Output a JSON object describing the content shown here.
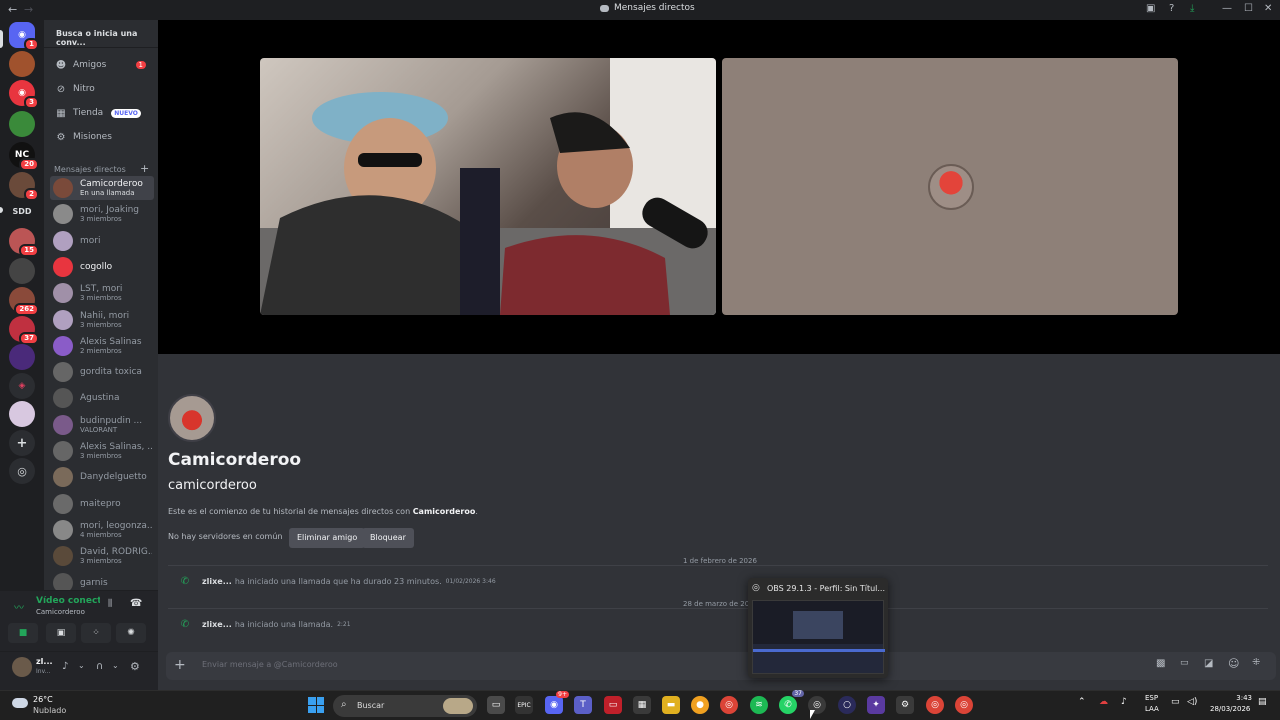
{
  "window": {
    "title": "Mensajes directos",
    "back_glyph": "←",
    "forward_glyph": "→",
    "controls": [
      "▣",
      "?",
      "⤓",
      "—",
      "☐",
      "✕"
    ]
  },
  "rail": {
    "badges": [
      "1",
      "3",
      "20",
      "2",
      "15",
      "262",
      "37"
    ],
    "sdd_label": "SDD",
    "nc_label": "NC"
  },
  "sidebar": {
    "search_placeholder": "Busca o inicia una conv...",
    "nav": [
      {
        "label": "Amigos",
        "icon": "friends-icon",
        "badge": "1"
      },
      {
        "label": "Nitro",
        "icon": "nitro-icon"
      },
      {
        "label": "Tienda",
        "icon": "shop-icon",
        "tag": "NUEVO"
      },
      {
        "label": "Misiones",
        "icon": "quests-icon"
      }
    ],
    "dm_header": "Mensajes directos",
    "dm_add": "+",
    "dms": [
      {
        "name": "Camicorderoo",
        "sub": "En una llamada",
        "color": "#7a4a3a"
      },
      {
        "name": "mori, Joaking",
        "sub": "3 miembros",
        "color": "#8a8a8a"
      },
      {
        "name": "mori",
        "sub": "",
        "color": "#b0a0c0"
      },
      {
        "name": "cogollo",
        "sub": "",
        "color": "#e8353f"
      },
      {
        "name": "LST, mori",
        "sub": "3 miembros",
        "color": "#a090a8"
      },
      {
        "name": "Nahii, mori",
        "sub": "3 miembros",
        "color": "#b0a0c0"
      },
      {
        "name": "Alexis Salinas",
        "sub": "2 miembros",
        "color": "#8a5cc8"
      },
      {
        "name": "gordita toxica",
        "sub": "",
        "color": "#666"
      },
      {
        "name": "Agustina",
        "sub": "",
        "color": "#555"
      },
      {
        "name": "budinpudin ...",
        "sub": "VALORANT",
        "color": "#7a5a8a"
      },
      {
        "name": "Alexis Salinas, ...",
        "sub": "3 miembros",
        "color": "#666"
      },
      {
        "name": "Danydelguetto",
        "sub": "",
        "color": "#7a6a5a"
      },
      {
        "name": "maitepro",
        "sub": "",
        "color": "#6a6a6a"
      },
      {
        "name": "mori, leogonza...",
        "sub": "4 miembros",
        "color": "#888"
      },
      {
        "name": "David, RODRIG...",
        "sub": "3 miembros",
        "color": "#5a4a3a"
      },
      {
        "name": "garnis",
        "sub": "",
        "color": "#555"
      }
    ]
  },
  "voice": {
    "status": "Vídeo conectad",
    "channel": "Camicorderoo",
    "user_name": "zl...",
    "user_status": "Inv..."
  },
  "chat": {
    "display_name": "Camicorderoo",
    "username": "camicorderoo",
    "intro_prefix": "Este es el comienzo de tu historial de mensajes directos con ",
    "intro_name": "Camicorderoo",
    "intro_suffix": ".",
    "no_servers": "No hay servidores en común",
    "remove_friend": "Eliminar amigo",
    "block": "Bloquear",
    "date1": "1 de febrero de 2026",
    "call1_user": "zlixe...",
    "call1_text": "ha iniciado una llamada que ha durado 23 minutos.",
    "call1_time": "01/02/2026 3:46",
    "date2": "28 de marzo de 2026",
    "call2_user": "zlixe...",
    "call2_text": "ha iniciado una llamada.",
    "call2_time": "2:21",
    "composer_placeholder": "Enviar mensaje a @Camicorderoo"
  },
  "obs_preview": {
    "title": "OBS 29.1.3 - Perfil: Sin Títul..."
  },
  "taskbar": {
    "weather_temp": "26°C",
    "weather_desc": "Nublado",
    "search_label": "Buscar",
    "lang1": "ESP",
    "lang2": "LAA",
    "time": "3:43",
    "date": "28/03/2026",
    "badge_discord": "9+",
    "badge_whatsapp": "37"
  }
}
